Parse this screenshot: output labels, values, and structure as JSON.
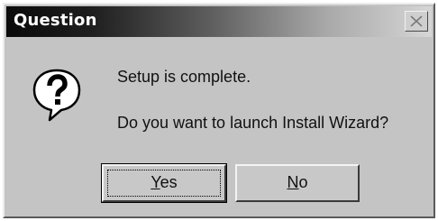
{
  "window": {
    "title": "Question"
  },
  "icons": {
    "dialog_icon": "question-balloon-icon",
    "close": "close-icon"
  },
  "message": {
    "line1": "Setup is complete.",
    "line2": "Do you want to launch Install Wizard?"
  },
  "buttons": {
    "yes": {
      "mnemonic": "Y",
      "rest": "es"
    },
    "no": {
      "mnemonic": "N",
      "rest": "o"
    }
  }
}
